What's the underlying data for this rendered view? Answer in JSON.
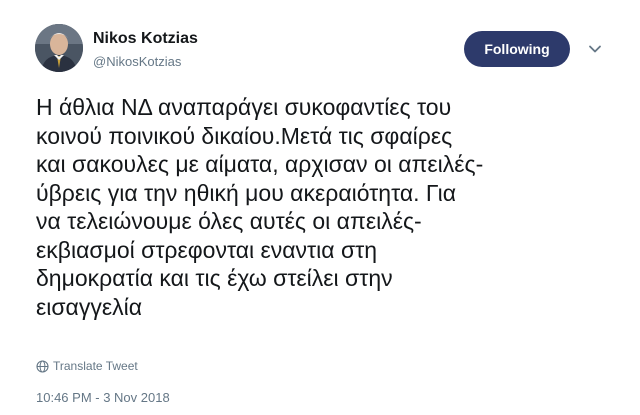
{
  "user": {
    "name": "Nikos Kotzias",
    "handle": "@NikosKotzias"
  },
  "follow_button": {
    "label": "Following"
  },
  "tweet": {
    "text": "Η άθλια ΝΔ αναπαράγει συκοφαντίες του\nκοινού ποινικού δικαίου.Μετά τις σφαίρες\nκαι σακουλες με αίματα, αρχισαν οι απειλές-\nύβρεις για την ηθική μου ακεραιότητα. Για\nνα τελειώνουμε όλες αυτές οι απειλές-\nεκβιασμοί στρεφονται εναντια στη\nδημοκρατία και τις έχω στείλει στην\nεισαγγελία",
    "translate_label": "Translate Tweet",
    "timestamp": "10:46 PM - 3 Nov 2018"
  },
  "colors": {
    "button_bg": "#2d3a6b",
    "secondary_text": "#657786",
    "primary_text": "#14171a"
  },
  "icons": {
    "translate": "globe-icon",
    "menu": "chevron-down-icon"
  }
}
